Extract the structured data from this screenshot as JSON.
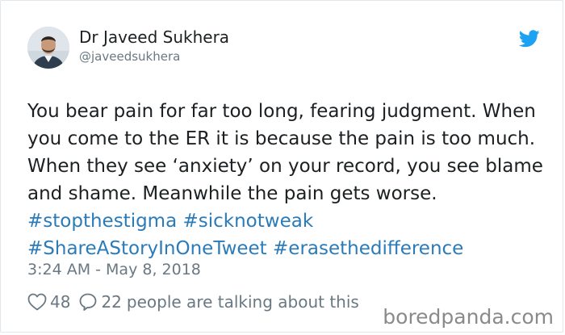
{
  "author": {
    "name": "Dr Javeed Sukhera",
    "handle": "@javeedsukhera"
  },
  "tweet": {
    "text_1": "You bear pain for far too long, fearing judgment. When you come to the ER it is because the pain is too much. When they see ‘anxiety’ on your record, you see blame and shame. Meanwhile the pain gets worse. ",
    "hashtags": [
      "#stopthestigma",
      "#sicknotweak",
      "#ShareAStoryInOneTweet",
      "#erasethedifference"
    ]
  },
  "timestamp": "3:24 AM - May 8, 2018",
  "actions": {
    "likes": "48",
    "replies": "22",
    "talking_text": "people are talking about this"
  },
  "watermark": "boredpanda.com",
  "colors": {
    "twitter_blue": "#1da1f2",
    "hashtag": "#2b7bb9",
    "muted": "#697882"
  },
  "icons": {
    "platform": "twitter-bird-icon",
    "like": "heart-icon",
    "reply": "speech-bubble-icon"
  }
}
